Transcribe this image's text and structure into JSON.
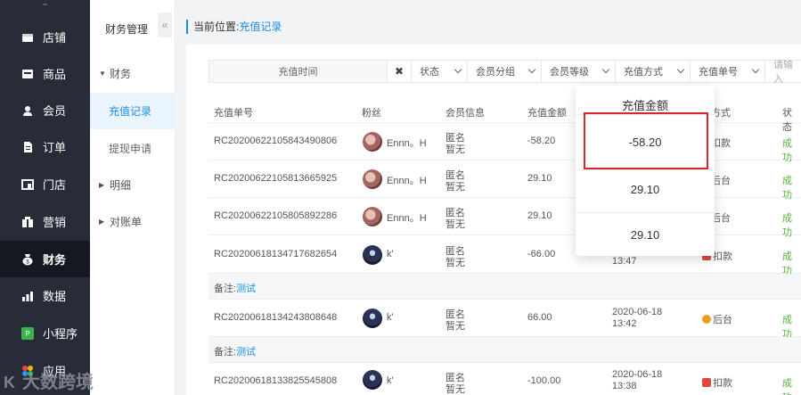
{
  "nav": {
    "top_icon": "menu-lines-icon",
    "items": [
      {
        "label": "店铺",
        "icon": "shop-icon"
      },
      {
        "label": "商品",
        "icon": "goods-icon"
      },
      {
        "label": "会员",
        "icon": "user-icon"
      },
      {
        "label": "订单",
        "icon": "order-icon"
      },
      {
        "label": "门店",
        "icon": "store-icon"
      },
      {
        "label": "营销",
        "icon": "marketing-icon"
      },
      {
        "label": "财务",
        "icon": "finance-icon"
      },
      {
        "label": "数据",
        "icon": "chart-icon"
      },
      {
        "label": "小程序",
        "icon": "miniapp-icon"
      },
      {
        "label": "应用",
        "icon": "app-icon"
      }
    ]
  },
  "sub": {
    "title": "财务管理",
    "collapse_icon": "«",
    "items": [
      {
        "label": "财务",
        "type": "group"
      },
      {
        "label": "充值记录",
        "type": "leaf"
      },
      {
        "label": "提现申请",
        "type": "leaf"
      },
      {
        "label": "明细",
        "type": "group"
      },
      {
        "label": "对账单",
        "type": "group"
      }
    ]
  },
  "breadcrumb": {
    "prefix": "当前位置:",
    "current": "充值记录"
  },
  "filters": {
    "time_placeholder": "充值时间",
    "clear": "✖",
    "status": "状态",
    "member_group": "会员分组",
    "member_level": "会员等级",
    "pay_method": "充值方式",
    "order_no": "充值单号",
    "input_placeholder": "请输入"
  },
  "table": {
    "headers": [
      "充值单号",
      "粉丝",
      "会员信息",
      "充值金额",
      "",
      "方式",
      "状态"
    ],
    "rows": [
      {
        "order": "RC20200622105843490806",
        "fan": "Ennn。H",
        "avatar": "av1",
        "member": [
          "匿名",
          "暂无"
        ],
        "amount": "-58.20",
        "date": "",
        "time": "",
        "pay": "扣款",
        "status": "成功"
      },
      {
        "order": "RC20200622105813665925",
        "fan": "Ennn。H",
        "avatar": "av1",
        "member": [
          "匿名",
          "暂无"
        ],
        "amount": "29.10",
        "date": "",
        "time": "",
        "pay": "后台",
        "status": "成功"
      },
      {
        "order": "RC20200622105805892286",
        "fan": "Ennn。H",
        "avatar": "av1",
        "member": [
          "匿名",
          "暂无"
        ],
        "amount": "29.10",
        "date": "",
        "time": "",
        "pay": "后台",
        "status": "成功"
      },
      {
        "order": "RC20200618134717682654",
        "fan": "k'",
        "avatar": "av2",
        "member": [
          "匿名",
          "暂无"
        ],
        "amount": "-66.00",
        "date": "",
        "time": "13:47",
        "pay": "扣款",
        "status": "成功"
      },
      {
        "order": "RC20200618134243808648",
        "fan": "k'",
        "avatar": "av2",
        "member": [
          "匿名",
          "暂无"
        ],
        "amount": "66.00",
        "date": "2020-06-18",
        "time": "13:42",
        "pay": "后台",
        "status": "成功"
      },
      {
        "order": "RC20200618133825545808",
        "fan": "k'",
        "avatar": "av2",
        "member": [
          "匿名",
          "暂无"
        ],
        "amount": "-100.00",
        "date": "2020-06-18",
        "time": "13:38",
        "pay": "扣款",
        "status": "成功"
      }
    ],
    "note_label": "备注:",
    "note_value": "测试"
  },
  "popover": {
    "header": "充值金额",
    "values": [
      "-58.20",
      "29.10",
      "29.10"
    ]
  },
  "watermark": "大数跨境",
  "colors": {
    "accent": "#1b8de3",
    "success": "#52b43a",
    "highlight": "#d7262b",
    "nav_bg": "#272c38",
    "debit_tag": "#e0473b",
    "backend_tag": "#e8a020"
  }
}
